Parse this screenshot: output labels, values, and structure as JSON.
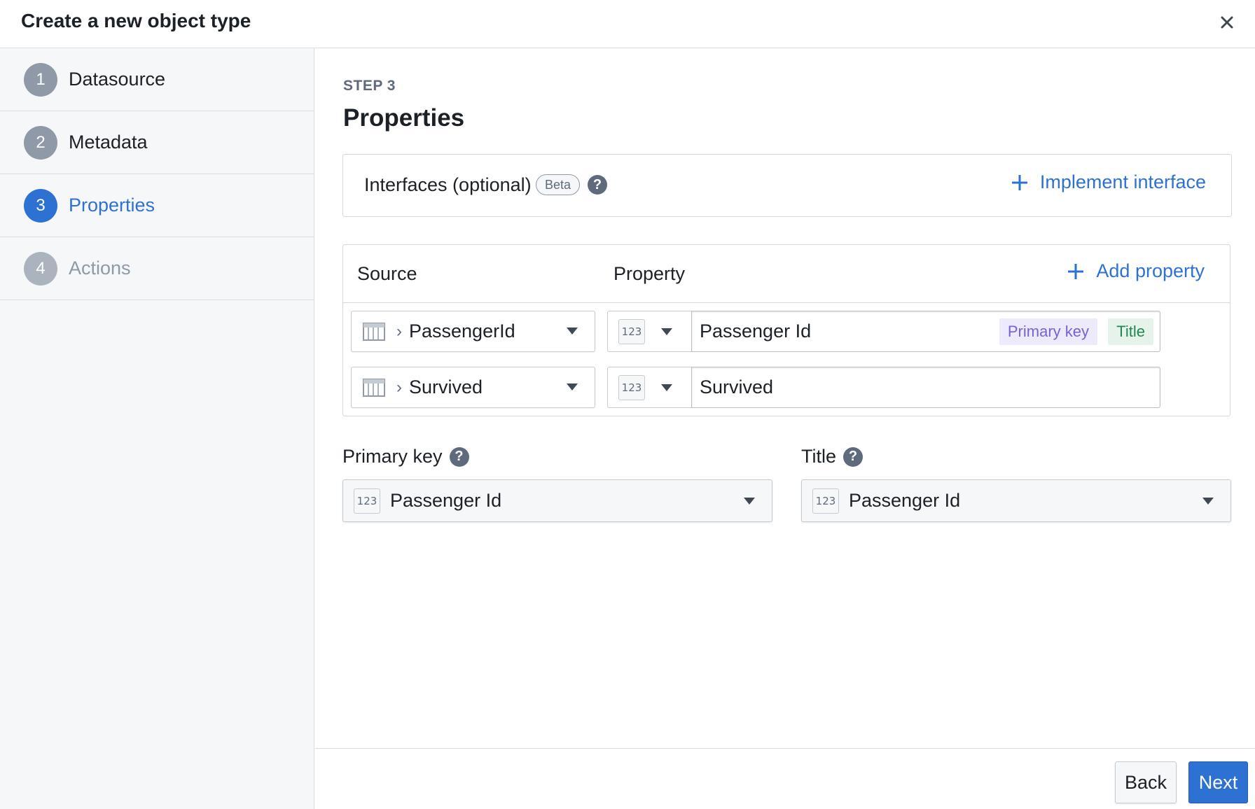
{
  "dialog": {
    "title": "Create a new object type",
    "close_icon": "close-icon"
  },
  "steps": [
    {
      "number": "1",
      "label": "Datasource",
      "state": "completed"
    },
    {
      "number": "2",
      "label": "Metadata",
      "state": "completed"
    },
    {
      "number": "3",
      "label": "Properties",
      "state": "active"
    },
    {
      "number": "4",
      "label": "Actions",
      "state": "disabled"
    }
  ],
  "main": {
    "eyebrow": "STEP 3",
    "title": "Properties",
    "interfaces": {
      "label": "Interfaces (optional)",
      "beta_tag": "Beta",
      "help_icon": "question-circle-icon",
      "implement_label": "Implement interface",
      "implement_icon": "plus-icon"
    },
    "properties_table": {
      "col_source": "Source",
      "col_property": "Property",
      "add_label": "Add property",
      "add_icon": "plus-icon",
      "rows": [
        {
          "source": "PassengerId",
          "type_badge": "123",
          "name": "Passenger Id",
          "tags": [
            "Primary key",
            "Title"
          ]
        },
        {
          "source": "Survived",
          "type_badge": "123",
          "name": "Survived",
          "tags": []
        }
      ]
    },
    "primary_key": {
      "label": "Primary key",
      "type_badge": "123",
      "value": "Passenger Id"
    },
    "title_field": {
      "label": "Title",
      "type_badge": "123",
      "value": "Passenger Id"
    }
  },
  "footer": {
    "back_label": "Back",
    "next_label": "Next"
  },
  "colors": {
    "accent": "#2d72d2",
    "primary_key_tag": "#7961db",
    "title_tag": "#238551",
    "sidebar_bg": "#f6f7f9"
  }
}
